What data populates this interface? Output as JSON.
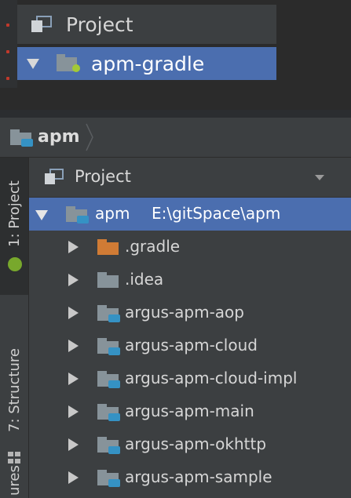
{
  "top_snippet": {
    "header_title": "Project",
    "root_label": "apm-gradle"
  },
  "breadcrumb": {
    "label": "apm"
  },
  "tool_strip": {
    "project_tab": "1: Project",
    "structure_tab": "7: Structure",
    "captures_tab": "ures"
  },
  "project_pane": {
    "view_selector": "Project",
    "root": {
      "name": "apm",
      "path": "E:\\gitSpace\\apm"
    },
    "children": [
      {
        "label": ".gradle",
        "icon": "excluded-folder-icon"
      },
      {
        "label": ".idea",
        "icon": "folder-icon"
      },
      {
        "label": "argus-apm-aop",
        "icon": "module-folder-icon"
      },
      {
        "label": "argus-apm-cloud",
        "icon": "module-folder-icon"
      },
      {
        "label": "argus-apm-cloud-impl",
        "icon": "module-folder-icon"
      },
      {
        "label": "argus-apm-main",
        "icon": "module-folder-icon"
      },
      {
        "label": "argus-apm-okhttp",
        "icon": "module-folder-icon"
      },
      {
        "label": "argus-apm-sample",
        "icon": "module-folder-icon"
      }
    ]
  },
  "colors": {
    "selection": "#4b6eaf",
    "background": "#3c3f41",
    "module_accent": "#3592c4",
    "excluded_folder": "#d07b35"
  }
}
